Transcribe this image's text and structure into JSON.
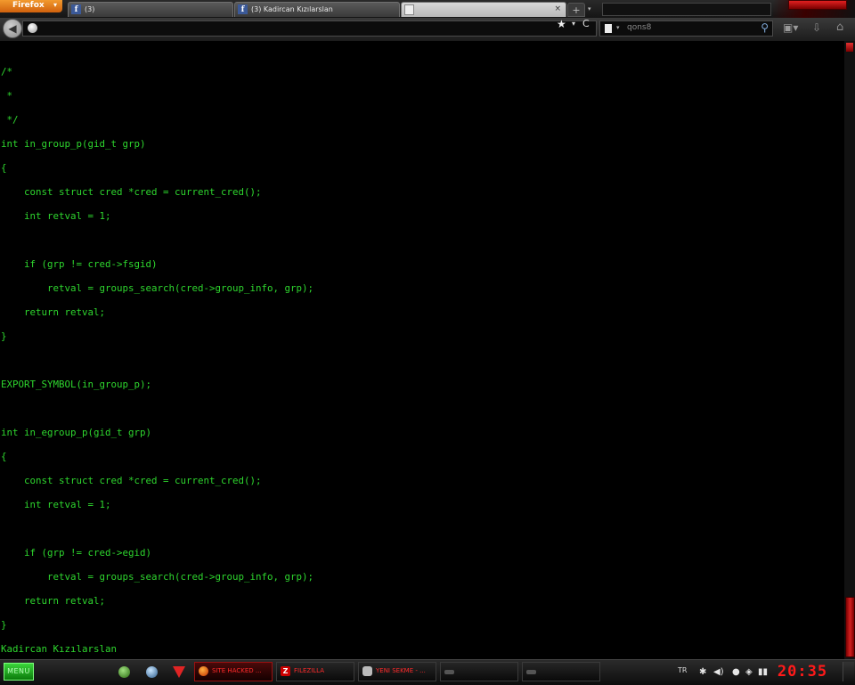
{
  "browser": {
    "menu_label": "Firefox",
    "menu_caret": "▾",
    "tabs": [
      {
        "label": "(3)",
        "icon": "facebook-icon",
        "icon_glyph": "f"
      },
      {
        "label": "(3) Kadircan Kızılarslan",
        "icon": "facebook-icon",
        "icon_glyph": "f"
      },
      {
        "label": "",
        "icon": "blank-page-icon",
        "close": "×"
      }
    ],
    "new_tab": "+",
    "tab_list": "▾",
    "back": "◀",
    "star": "★",
    "dropdown": "▾",
    "reload": "C",
    "search_placeholder": "qons8",
    "search_engine_caret": "▾",
    "search_button": "⚲",
    "toolbar_icons": [
      "bookmarks-icon",
      "download-icon",
      "home-icon"
    ],
    "toolbar_glyphs": [
      "▣▾",
      "⇩",
      "⌂"
    ]
  },
  "code_lines": [
    "/*",
    " *",
    " */",
    "int in_group_p(gid_t grp)",
    "{",
    "    const struct cred *cred = current_cred();",
    "    int retval = 1;",
    "",
    "    if (grp != cred->fsgid)",
    "        retval = groups_search(cred->group_info, grp);",
    "    return retval;",
    "}",
    "",
    "EXPORT_SYMBOL(in_group_p);",
    "",
    "int in_egroup_p(gid_t grp)",
    "{",
    "    const struct cred *cred = current_cred();",
    "    int retval = 1;",
    "",
    "    if (grp != cred->egid)",
    "        retval = groups_search(cred->group_info, grp);",
    "    return retval;",
    "}",
    "Kadircan Kızılarslan"
  ],
  "taskbar": {
    "menu_label": "MENU",
    "tasks": [
      {
        "label": "SITE HACKED ...",
        "icon": "firefox-icon"
      },
      {
        "label": "FILEZILLA",
        "icon": "filezilla-icon",
        "glyph": "Z"
      },
      {
        "label": "YENI SEKME - ...",
        "icon": "mail-icon"
      },
      {
        "label": "",
        "icon": "app-icon"
      },
      {
        "label": "",
        "icon": "app-icon"
      }
    ],
    "language": "TR",
    "tray_glyphs": [
      "✱",
      "◀)",
      "●",
      "◈",
      "▮▮"
    ],
    "clock": "20:35"
  },
  "colors": {
    "code_text": "#2ed62e",
    "accent_red": "#e02020",
    "background": "#000000"
  }
}
